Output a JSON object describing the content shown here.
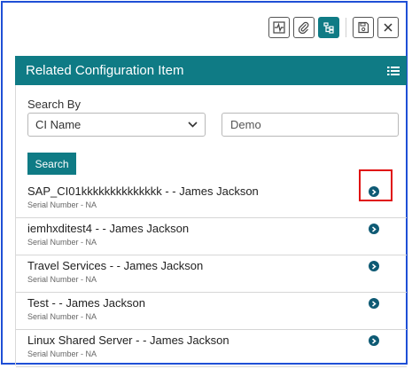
{
  "toolbar": {
    "buttons": [
      {
        "icon": "activity-icon"
      },
      {
        "icon": "paperclip-icon"
      },
      {
        "icon": "hierarchy-icon",
        "active": true
      },
      {
        "icon": "save-icon"
      },
      {
        "icon": "close-icon"
      }
    ]
  },
  "panel": {
    "title": "Related Configuration Item",
    "menu_icon": "list-icon"
  },
  "search": {
    "label": "Search By",
    "field_value": "CI Name",
    "input_value": "Demo",
    "button_label": "Search"
  },
  "results": [
    {
      "title": "SAP_CI01kkkkkkkkkkkkkk - - James Jackson",
      "subtitle": "Serial Number - NA",
      "highlighted": true
    },
    {
      "title": "iemhxditest4 - - James Jackson",
      "subtitle": "Serial Number - NA"
    },
    {
      "title": "Travel Services - - James Jackson",
      "subtitle": "Serial Number - NA"
    },
    {
      "title": "Test - - James Jackson",
      "subtitle": "Serial Number - NA"
    },
    {
      "title": "Linux Shared Server - - James Jackson",
      "subtitle": "Serial Number - NA"
    }
  ],
  "colors": {
    "accent": "#0f7b85",
    "go_icon": "#0e5a74",
    "highlight_box": "#e01010",
    "frame": "#1f4fd6"
  }
}
